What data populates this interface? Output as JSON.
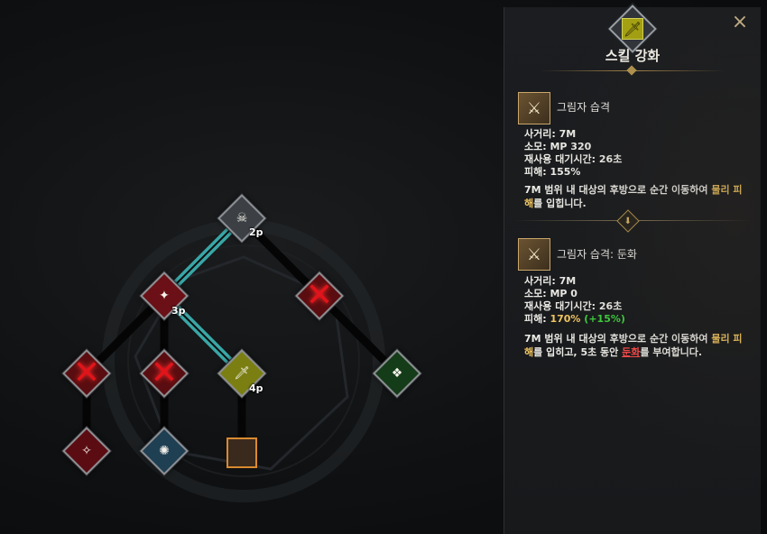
{
  "panel": {
    "title": "스킬 강화",
    "close_icon": "×",
    "base_skill": {
      "name": "그림자 습격",
      "range": "사거리: 7M",
      "cost": "소모: MP 320",
      "cooldown": "재사용 대기시간: 26초",
      "damage": "피해: 155%",
      "desc_pre": "7M 범위 내 대상의 후방으로 순간 이동하여 ",
      "desc_hl": "물리 피해",
      "desc_post": "를 입힙니다."
    },
    "upgraded_skill": {
      "name": "그림자 습격: 둔화",
      "range": "사거리: 7M",
      "cost": "소모: MP 0",
      "cooldown": "재사용 대기시간: 26초",
      "damage_label": "피해: ",
      "damage_value": "170%",
      "damage_bonus": "(+15%)",
      "desc_pre": "7M 범위 내 대상의 후방으로 순간 이동하여 ",
      "desc_hl": "물리 피해",
      "desc_mid": "를 입히고, 5초 동안 ",
      "desc_status": "둔화",
      "desc_post": "를 부여합니다."
    }
  },
  "tree": {
    "points": {
      "root": "2p",
      "left": "3p",
      "mid": "4p"
    }
  },
  "colors": {
    "path_active": "#3aa6a6",
    "path_inactive": "#050505",
    "accent_gold": "#f0c560",
    "accent_green": "#3ed13e",
    "accent_red": "#ff4a4a"
  }
}
